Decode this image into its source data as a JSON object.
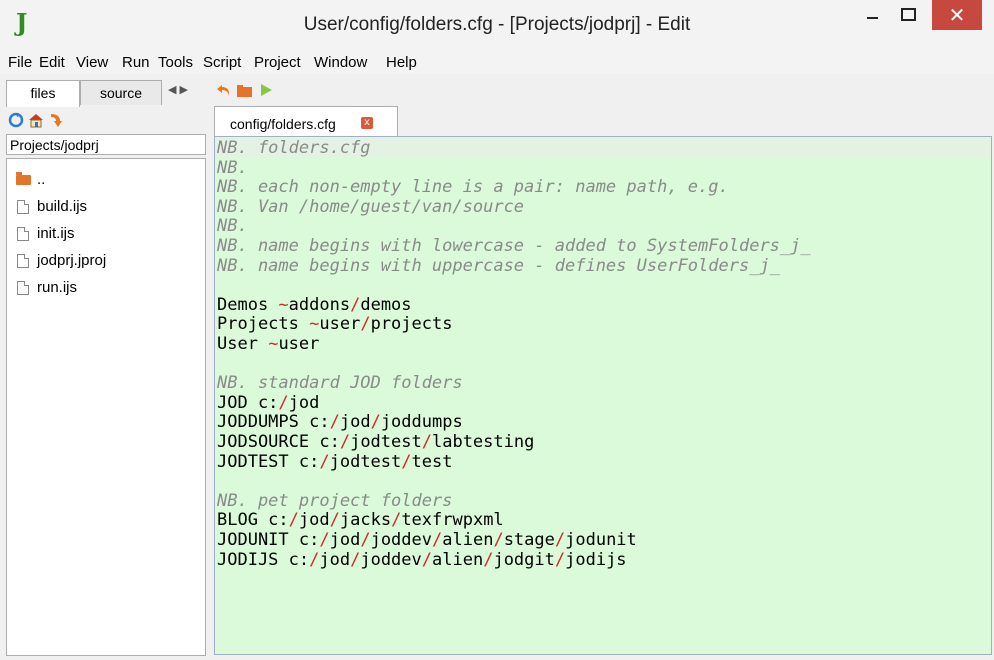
{
  "window": {
    "app_logo": "J",
    "title": "User/config/folders.cfg - [Projects/jodprj] - Edit",
    "close_glyph": "✕"
  },
  "menu": [
    "File",
    "Edit",
    "View",
    "Run",
    "Tools",
    "Script",
    "Project",
    "Window",
    "Help"
  ],
  "left_panel": {
    "tabs": [
      "files",
      "source"
    ],
    "active_tab": "files",
    "toolbar_icons": [
      "refresh-icon",
      "home-icon",
      "arrow-icon"
    ],
    "path": "Projects/jodprj",
    "files": [
      {
        "name": "..",
        "type": "folder"
      },
      {
        "name": "build.ijs",
        "type": "file"
      },
      {
        "name": "init.ijs",
        "type": "file"
      },
      {
        "name": "jodprj.jproj",
        "type": "file"
      },
      {
        "name": "run.ijs",
        "type": "file"
      }
    ]
  },
  "editor_toolbar_icons": [
    "undo-icon",
    "open-folder-icon",
    "run-icon"
  ],
  "editor": {
    "tab_label": "config/folders.cfg",
    "close_glyph": "x",
    "lines": [
      {
        "text": "NB. folders.cfg",
        "comment": true
      },
      {
        "text": "NB.",
        "comment": true
      },
      {
        "text": "NB. each non-empty line is a pair: name path, e.g.",
        "comment": true
      },
      {
        "text": "NB. Van /home/guest/van/source",
        "comment": true
      },
      {
        "text": "NB.",
        "comment": true
      },
      {
        "text": "NB. name begins with lowercase - added to SystemFolders_j_",
        "comment": true
      },
      {
        "text": "NB. name begins with uppercase - defines UserFolders_j_",
        "comment": true
      },
      {
        "text": "",
        "comment": false
      },
      {
        "text": "Demos ~addons/demos",
        "comment": false
      },
      {
        "text": "Projects ~user/projects",
        "comment": false
      },
      {
        "text": "User ~user",
        "comment": false
      },
      {
        "text": "",
        "comment": false
      },
      {
        "text": "NB. standard JOD folders",
        "comment": true
      },
      {
        "text": "JOD c:/jod",
        "comment": false
      },
      {
        "text": "JODDUMPS c:/jod/joddumps",
        "comment": false
      },
      {
        "text": "JODSOURCE c:/jodtest/labtesting",
        "comment": false
      },
      {
        "text": "JODTEST c:/jodtest/test",
        "comment": false
      },
      {
        "text": "",
        "comment": false
      },
      {
        "text": "NB. pet project folders",
        "comment": true
      },
      {
        "text": "BLOG c:/jod/jacks/texfrwpxml",
        "comment": false
      },
      {
        "text": "JODUNIT c:/jod/joddev/alien/stage/jodunit",
        "comment": false
      },
      {
        "text": "JODIJS c:/jod/joddev/alien/jodgit/jodijs",
        "comment": false
      }
    ]
  },
  "colors": {
    "editor_bg": "#dafada",
    "path_separator": "#d12a2a",
    "comment": "#8a8a8a",
    "close_button": "#c7483f"
  }
}
